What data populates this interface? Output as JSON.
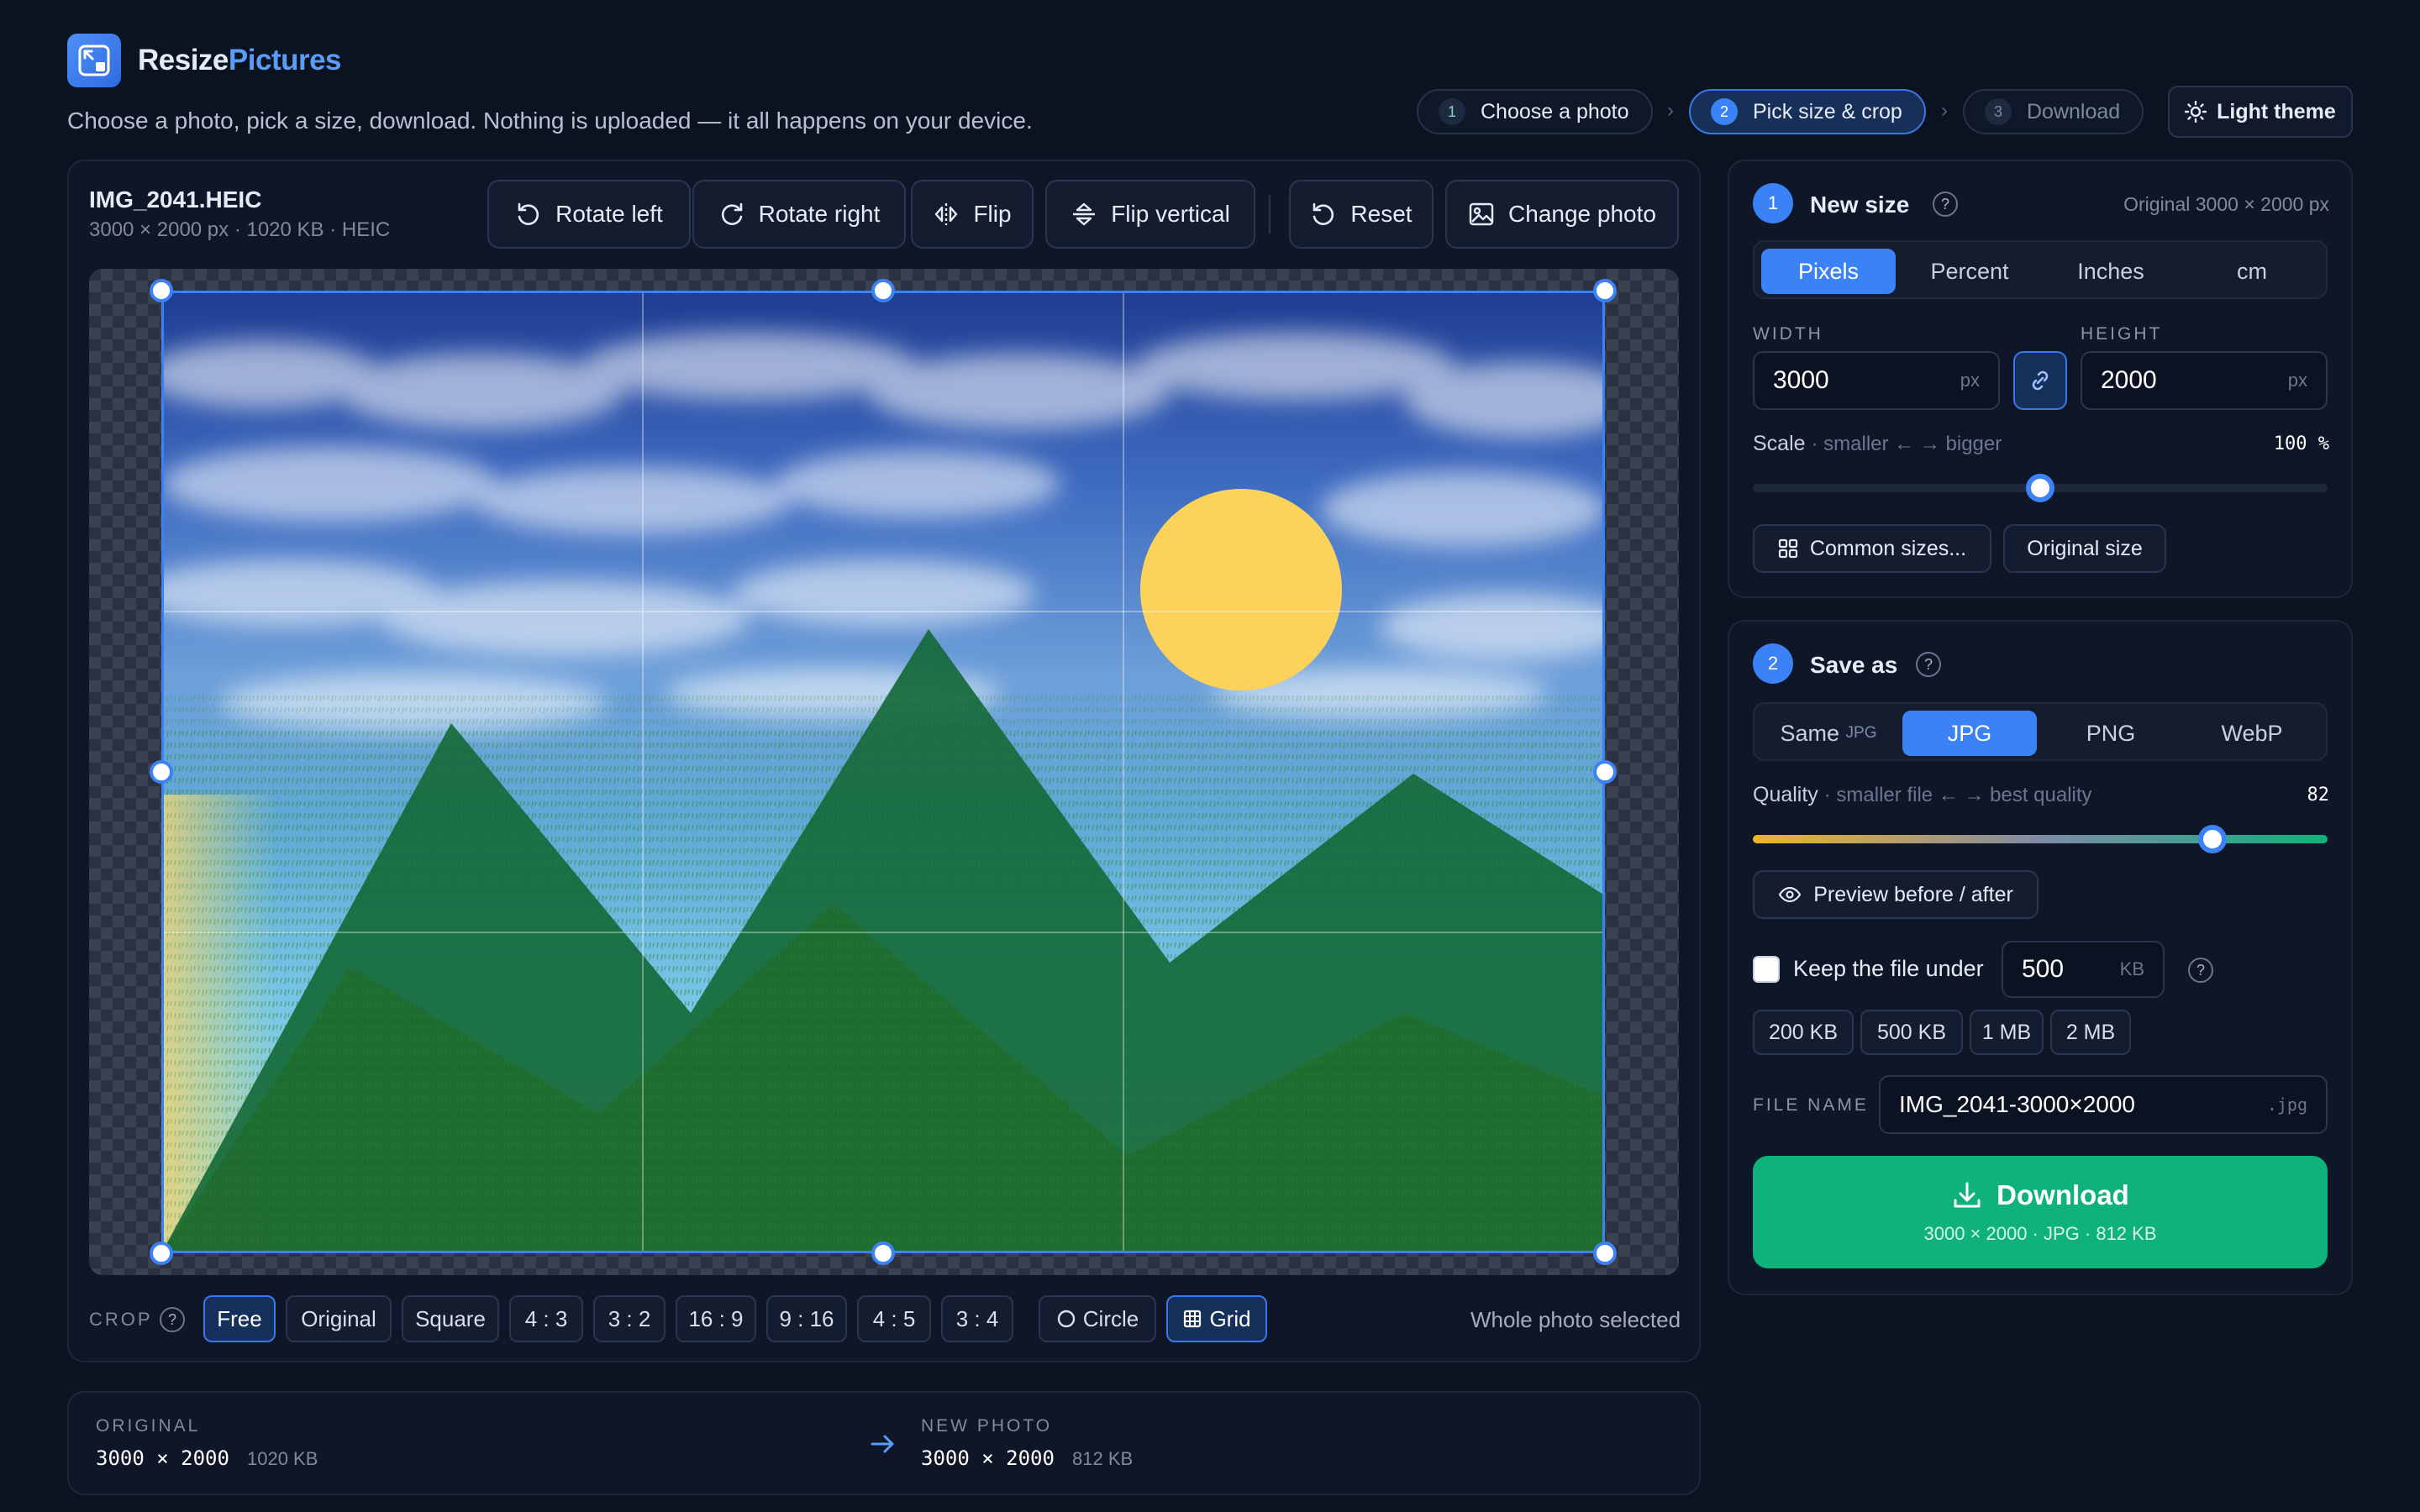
{
  "brand": {
    "part1": "Resize",
    "part2": "Pictures"
  },
  "tagline": "Choose a photo, pick a size, download. Nothing is uploaded — it all happens on your device.",
  "steps": [
    {
      "num": "1",
      "label": "Choose a photo"
    },
    {
      "num": "2",
      "label": "Pick size & crop"
    },
    {
      "num": "3",
      "label": "Download"
    }
  ],
  "theme_button": "Light theme",
  "file": {
    "name": "IMG_2041.HEIC",
    "meta": "3000 × 2000 px · 1020 KB · HEIC"
  },
  "toolbar": {
    "rotate_left": "Rotate left",
    "rotate_right": "Rotate right",
    "flip": "Flip",
    "flip_vertical": "Flip vertical",
    "reset": "Reset",
    "change_photo": "Change photo"
  },
  "crop": {
    "label": "CROP",
    "help": "?",
    "options": [
      "Free",
      "Original",
      "Square",
      "4 : 3",
      "3 : 2",
      "16 : 9",
      "9 : 16",
      "4 : 5",
      "3 : 4"
    ],
    "selected": "Free",
    "circle": "Circle",
    "grid": "Grid",
    "status": "Whole photo selected"
  },
  "summary": {
    "original_label": "ORIGINAL",
    "original_dims": "3000 × 2000",
    "original_size": "1020 KB",
    "new_label": "NEW PHOTO",
    "new_dims": "3000 × 2000",
    "new_size": "812 KB"
  },
  "new_size": {
    "step": "1",
    "title": "New size",
    "help": "?",
    "original": "Original 3000 × 2000 px",
    "units": [
      "Pixels",
      "Percent",
      "Inches",
      "cm"
    ],
    "selected_unit": "Pixels",
    "width_label": "WIDTH",
    "width": "3000",
    "height_label": "HEIGHT",
    "height": "2000",
    "unit": "px",
    "scale_label": "Scale",
    "scale_hint": "· smaller ← → bigger",
    "scale_value": "100 %",
    "scale_fraction": 0.5,
    "common_sizes": "Common sizes...",
    "original_size": "Original size"
  },
  "save_as": {
    "step": "2",
    "title": "Save as",
    "help": "?",
    "formats": [
      {
        "label": "Same",
        "sub": "JPG"
      },
      {
        "label": "JPG"
      },
      {
        "label": "PNG"
      },
      {
        "label": "WebP"
      }
    ],
    "selected": "JPG",
    "quality_label": "Quality",
    "quality_hint": "· smaller file ← → best quality",
    "quality_value": "82",
    "quality_fraction": 0.8,
    "preview": "Preview before / after",
    "keep_under_label": "Keep the file under",
    "keep_under_value": "500",
    "keep_under_unit": "KB",
    "presets": [
      "200 KB",
      "500 KB",
      "1 MB",
      "2 MB"
    ],
    "file_name_label": "FILE NAME",
    "file_name": "IMG_2041-3000×2000",
    "ext": ".jpg"
  },
  "download": {
    "label": "Download",
    "meta": "3000 × 2000 · JPG · 812 KB"
  },
  "colors": {
    "accent": "#3b82f6",
    "download": "#10b27b",
    "background": "#0b1220"
  }
}
